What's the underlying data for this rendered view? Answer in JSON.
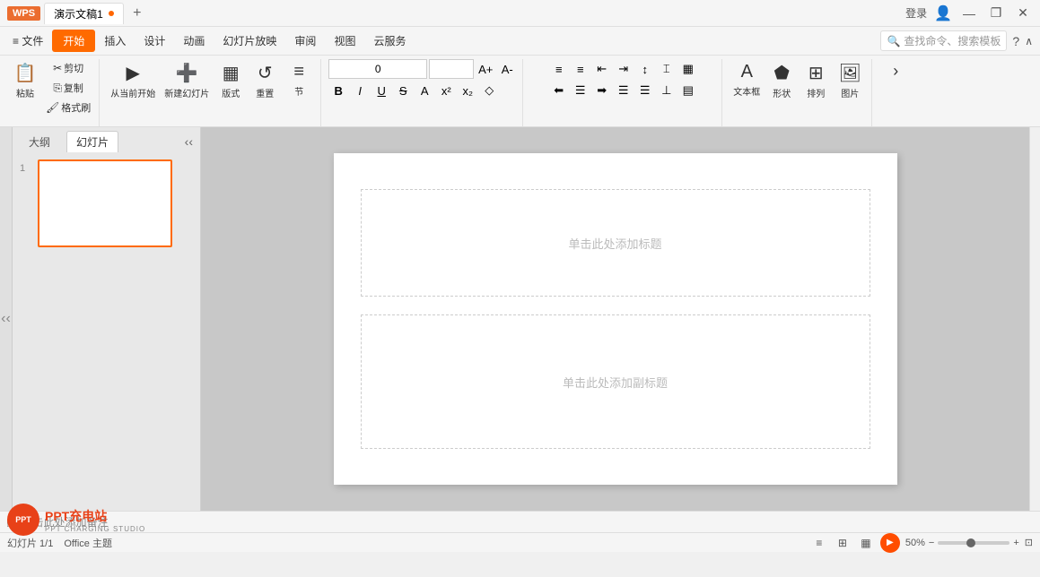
{
  "titlebar": {
    "wps_label": "WPS",
    "tab_name": "演示文稿1",
    "tab_add_label": "+",
    "login_label": "登录",
    "win_min": "—",
    "win_max": "□",
    "win_close": "✕",
    "win_restore": "❐"
  },
  "menubar": {
    "items": [
      "文件",
      "开始",
      "插入",
      "设计",
      "动画",
      "幻灯片放映",
      "审阅",
      "视图",
      "云服务"
    ],
    "active_index": 1,
    "search_placeholder": "查找命令、搜索模板",
    "help": "?",
    "expand": "∧"
  },
  "quickbar": {
    "items": [
      "□",
      "□",
      "↩",
      "↩",
      "↺",
      "▼"
    ]
  },
  "ribbon": {
    "paste_label": "粘贴",
    "cut_label": "剪切",
    "copy_label": "复制",
    "format_label": "格式刷",
    "new_slide_label": "新建幻灯片",
    "layout_label": "版式",
    "section_label": "节",
    "reset_label": "重置",
    "font_size_value": "0",
    "textbox_label": "文本框",
    "shape_label": "形状",
    "arrange_label": "排列",
    "image_label": "图片"
  },
  "panel": {
    "tab_outline": "大纲",
    "tab_slides": "幻灯片",
    "slide_number": "1"
  },
  "canvas": {
    "placeholder_top": "单击此处添加标题",
    "placeholder_bottom": "单击此处添加副标题"
  },
  "notebar": {
    "placeholder": "单击此处添加备注",
    "icon": "□"
  },
  "statusbar": {
    "slide_info": "幻灯片 1/1",
    "theme": "Office 主题",
    "zoom_level": "50%",
    "zoom_minus": "−",
    "zoom_plus": "+",
    "expand_icon": "⊡"
  },
  "watermark": {
    "logo_text": "PPT充电站",
    "sub_text": "PPT CHARGING STUDIO"
  }
}
